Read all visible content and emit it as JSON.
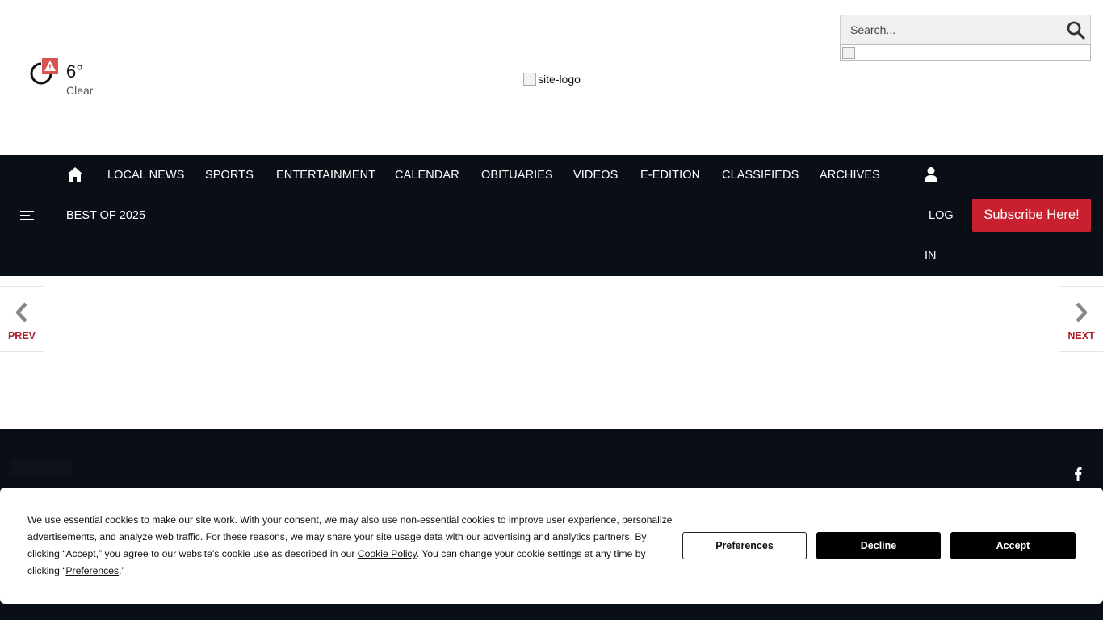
{
  "weather": {
    "temperature": "6°",
    "condition": "Clear",
    "icon": "weather-clear-icon",
    "alert_icon": "warning-triangle-icon",
    "alert_color": "#d9534f"
  },
  "logo": {
    "alt": "site-logo"
  },
  "search": {
    "placeholder": "Search...",
    "icon": "search-icon"
  },
  "nav": {
    "home_icon": "home-icon",
    "items": [
      {
        "label": "LOCAL NEWS"
      },
      {
        "label": "SPORTS"
      },
      {
        "label": "ENTERTAINMENT"
      },
      {
        "label": "CALENDAR"
      },
      {
        "label": "OBITUARIES"
      },
      {
        "label": "VIDEOS"
      },
      {
        "label": "E-EDITION"
      },
      {
        "label": "CLASSIFIEDS"
      },
      {
        "label": "ARCHIVES"
      }
    ],
    "menu_icon": "hamburger-menu-icon",
    "best_of": "BEST OF 2025",
    "user_icon": "user-icon",
    "login_line1": "LOG",
    "login_line2": "IN",
    "subscribe_label": "Subscribe Here!",
    "background_color": "#0a0e16",
    "accent_color": "#c8202f"
  },
  "gallery": {
    "prev_label": "PREV",
    "next_label": "NEXT",
    "prev_icon": "chevron-left-icon",
    "next_icon": "chevron-right-icon",
    "label_color": "#b01c2a"
  },
  "footer": {
    "social_icon": "facebook-icon"
  },
  "cookie": {
    "text_part1": "We use essential cookies to make our site work. With your consent, we may also use non-essential cookies to improve user experience, personalize advertisements, and analyze web traffic. For these reasons, we may share your site usage data with our advertising and analytics partners. By clicking “Accept,” you agree to our website's cookie use as described in our ",
    "policy_link": "Cookie Policy",
    "text_part2": ". You can change your cookie settings at any time by clicking “",
    "preferences_link": "Preferences",
    "text_part3": ".”",
    "preferences_button": "Preferences",
    "decline_button": "Decline",
    "accept_button": "Accept"
  }
}
